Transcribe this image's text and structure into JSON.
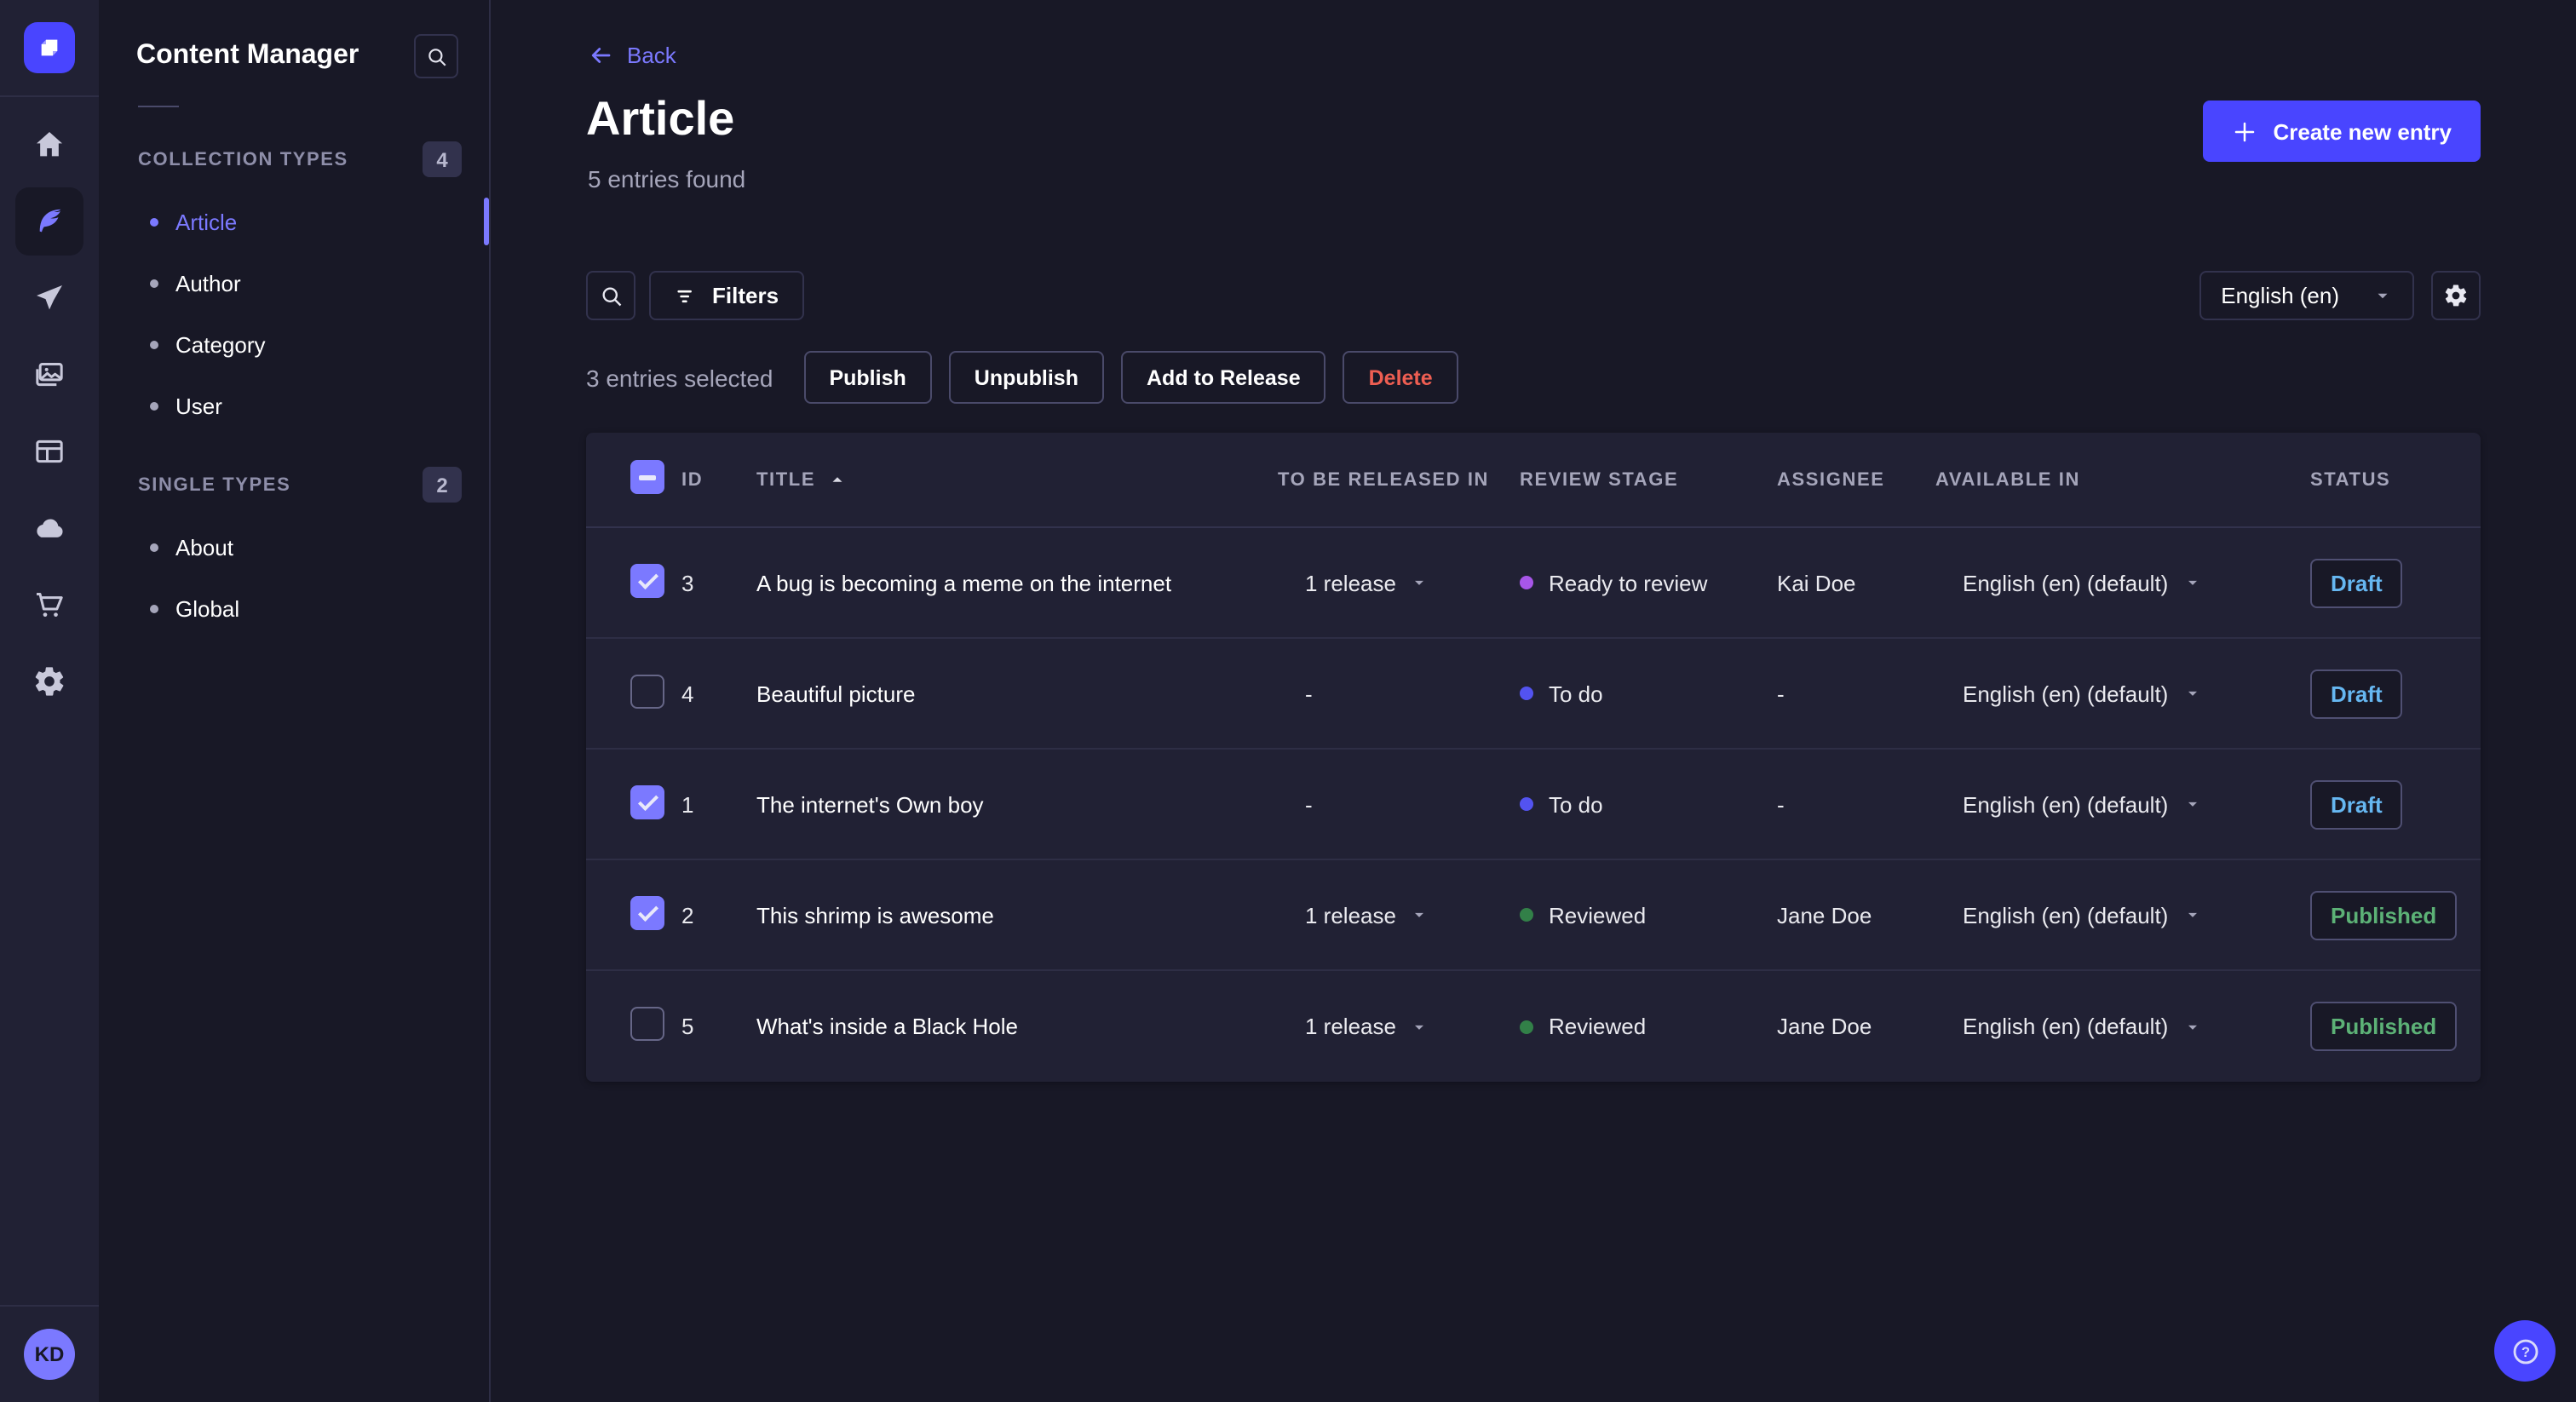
{
  "rail": {
    "avatar_initials": "KD",
    "icons": [
      "strapi-logo",
      "home",
      "content-manager",
      "releases",
      "media-library",
      "content-type-builder",
      "cloud",
      "marketplace",
      "settings"
    ]
  },
  "sidebar": {
    "title": "Content Manager",
    "sections": [
      {
        "label": "COLLECTION TYPES",
        "count": "4",
        "items": [
          {
            "label": "Article",
            "active": true
          },
          {
            "label": "Author",
            "active": false
          },
          {
            "label": "Category",
            "active": false
          },
          {
            "label": "User",
            "active": false
          }
        ]
      },
      {
        "label": "SINGLE TYPES",
        "count": "2",
        "items": [
          {
            "label": "About",
            "active": false
          },
          {
            "label": "Global",
            "active": false
          }
        ]
      }
    ]
  },
  "header": {
    "back_label": "Back",
    "title": "Article",
    "subtitle": "5 entries found",
    "create_button": "Create new entry"
  },
  "toolbar": {
    "filters_label": "Filters",
    "locale": "English (en)"
  },
  "selection": {
    "text": "3 entries selected",
    "actions": [
      {
        "label": "Publish",
        "variant": "default"
      },
      {
        "label": "Unpublish",
        "variant": "default"
      },
      {
        "label": "Add to Release",
        "variant": "default"
      },
      {
        "label": "Delete",
        "variant": "danger"
      }
    ]
  },
  "table": {
    "columns": [
      "ID",
      "TITLE",
      "TO BE RELEASED IN",
      "REVIEW STAGE",
      "ASSIGNEE",
      "AVAILABLE IN",
      "STATUS"
    ],
    "sorted_column": "TITLE",
    "sort_direction": "asc",
    "header_checkbox": "indeterminate",
    "rows": [
      {
        "id": "3",
        "title": "A bug is becoming a meme on the internet",
        "release": "1 release",
        "review_stage": "Ready to review",
        "assignee": "Kai Doe",
        "available_in": "English (en) (default)",
        "status": "Draft",
        "checked": true
      },
      {
        "id": "4",
        "title": "Beautiful picture",
        "release": "-",
        "review_stage": "To do",
        "assignee": "-",
        "available_in": "English (en) (default)",
        "status": "Draft",
        "checked": false
      },
      {
        "id": "1",
        "title": "The internet's Own boy",
        "release": "-",
        "review_stage": "To do",
        "assignee": "-",
        "available_in": "English (en) (default)",
        "status": "Draft",
        "checked": true
      },
      {
        "id": "2",
        "title": "This shrimp is awesome",
        "release": "1 release",
        "review_stage": "Reviewed",
        "assignee": "Jane Doe",
        "available_in": "English (en) (default)",
        "status": "Published",
        "checked": true
      },
      {
        "id": "5",
        "title": "What's inside a Black Hole",
        "release": "1 release",
        "review_stage": "Reviewed",
        "assignee": "Jane Doe",
        "available_in": "English (en) (default)",
        "status": "Published",
        "checked": false
      }
    ]
  },
  "review_stage_colors": {
    "To do": "#5353f0",
    "Ready to review": "#a756e8",
    "Reviewed": "#328048"
  },
  "status_colors": {
    "Draft": "#66b7f1",
    "Published": "#5cb176"
  },
  "colors": {
    "accent": "#4945ff",
    "link": "#7b79ff",
    "danger": "#ee5e52",
    "page_bg": "#181826",
    "rail_bg": "#212134",
    "card_bg": "#212134",
    "border": "#32324d",
    "muted_text": "#a5a5ba"
  }
}
